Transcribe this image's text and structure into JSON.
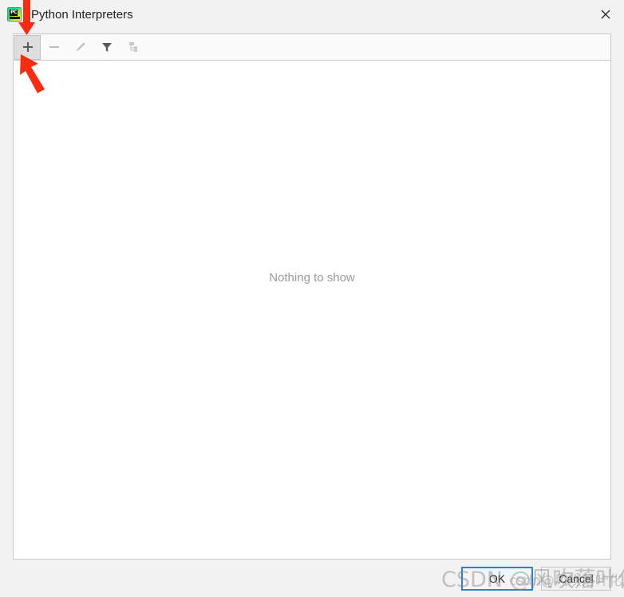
{
  "window": {
    "title": "Python Interpreters",
    "app_icon": "pycharm-icon",
    "app_icon_label": "PC",
    "close_label": "✕"
  },
  "toolbar": {
    "buttons": [
      {
        "name": "add-interpreter-button",
        "icon": "plus-icon",
        "state": "active",
        "tooltip": "Add"
      },
      {
        "name": "remove-interpreter-button",
        "icon": "minus-icon",
        "state": "disabled",
        "tooltip": "Remove"
      },
      {
        "name": "edit-interpreter-button",
        "icon": "pencil-icon",
        "state": "disabled",
        "tooltip": "Edit"
      },
      {
        "name": "filter-button",
        "icon": "funnel-icon",
        "state": "enabled",
        "tooltip": "Filter"
      },
      {
        "name": "show-paths-button",
        "icon": "hierarchy-icon",
        "state": "disabled",
        "tooltip": "Show paths"
      }
    ]
  },
  "content": {
    "empty_state_text": "Nothing to show"
  },
  "footer": {
    "ok_label": "OK",
    "cancel_label": "Cancel"
  },
  "annotations": {
    "arrow_color": "#f92b10",
    "arrows": [
      {
        "name": "annotation-arrow-down",
        "direction": "down"
      },
      {
        "name": "annotation-arrow-up",
        "direction": "up-left"
      }
    ]
  },
  "watermarks": {
    "main": "CSDN @风吹落叶化成泥",
    "sub": "csdn@风吹落叶化成泥"
  },
  "colors": {
    "accent_blue": "#2f7fd0",
    "arrow_red": "#f92b10",
    "panel_bg": "#ffffff",
    "dialog_bg": "#f2f2f2",
    "empty_text": "#9a9a9a"
  }
}
